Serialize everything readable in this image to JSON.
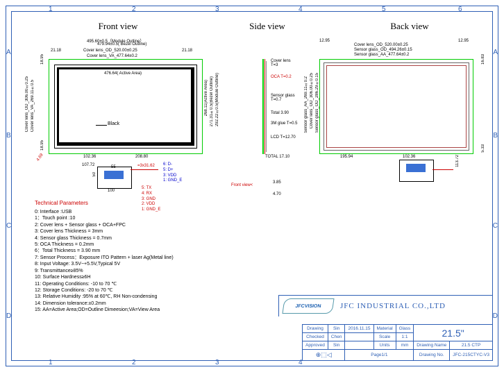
{
  "ruler_cols": [
    "1",
    "2",
    "3",
    "4",
    "5",
    "6"
  ],
  "ruler_rows": [
    "A",
    "B",
    "C",
    "D"
  ],
  "views": {
    "front": "Front view",
    "side": "Side view",
    "back": "Back view"
  },
  "front_dims": {
    "module_outline": "495.60±0.5（Module Outline）",
    "bezel_outline": "479.94±0.5( Bezel Outline)",
    "cover_lens_od": "Cover lens_OD_520.00±0.25",
    "cover_lens_va": "Cover lens_VA_477.64±0.2",
    "left": "21.18",
    "right": "21.18",
    "top_gap_l": "18.95",
    "bot_gap_l": "18.95",
    "active_area": "476.64( Active Area)",
    "vert_od": "Cover lens_OD_306.00±0.25",
    "vert_va": "Cover lens_VA_269.11±0.5",
    "va_268": "268.11(Active Area)",
    "bezel_h": "271.31±0.5(Bezel Outline)",
    "mod_h": "292.22±0.5(Module Outline)",
    "black": "Black",
    "btm_102": "102.36",
    "btm_208": "208.80",
    "btm_107": "107.72",
    "conn_h": "50",
    "conn_w": "100",
    "conn_mid": "55",
    "pitch": "=3x31.62",
    "angle": "4.69"
  },
  "side_dims": {
    "cover_lens": "Cover lens\nT=3",
    "oca": "OCA T=0.2",
    "sensor": "Sensor glass\nT=0.7",
    "total390": "Total 3.90",
    "glue": "3M glue T=0.5",
    "lcd": "LCD T=12.70",
    "total": "TOTAL 17.10",
    "front_arrow": "Front view<",
    "v385": "3.85",
    "v470": "4.70"
  },
  "back_dims": {
    "top_1295": "12.95",
    "cover_od": "Cover lens_OD_520.00±0.25",
    "sensor_od": "Sensor glass_OD_494.26±0.15",
    "sensor_va": "Sensor glass_AA_477.64±0.2",
    "vert_side": "16.83",
    "vert_aa": "Sensor glass_AA_269.11±0.2",
    "vert_od": "Cover lens_OD_306.00±0.25",
    "vert_sod": "Sensor glass_OD_286.29±0.15",
    "vert_533": "5.33",
    "btm_195": "195.94",
    "btm_102": "102.36",
    "btm_113": "113.72"
  },
  "wires_blue": {
    "l6": "6: D-",
    "l5": "5: D+",
    "l3": "3: VDD",
    "l1": "1: GND_E"
  },
  "wires_red": {
    "l5": "5: TX",
    "l4": "4: RX",
    "l3": "3: GND",
    "l2": "2: VDD",
    "l1": "1: GND_E"
  },
  "tech": {
    "title": "Technical Parameters",
    "l0": "0: Interface :USB",
    "l1": "1：Touch point :10",
    "l2": "2: Cover lens + Sensor glass + OCA+FPC",
    "l3": "3: Cover lens Thickness = 3mm",
    "l4": "4: Sensor glass Thickness = 0.7mm",
    "l5": "5: OCA Thickness = 0.2mm",
    "l6": "6：Total Thickness = 3.90 mm",
    "l7": "7: Sensor Process：Exposure ITO Pattern + laser Ag(Metal line)",
    "l8": "8: Input Voltage: 3.5V~+5.5V,Typical 5V",
    "l9": "9: Transmittance≥85%",
    "l10": "10: Surface Hardness≥6H",
    "l11": "11: Operating Conditions: -10 to 70 ℃",
    "l12": "12: Storage Conditions: -20 to 70 ℃",
    "l13": "13: Relative Humidity :95% at 60℃, RH Non-condensing",
    "l14": "14: Dimension tolerance:±0.2mm",
    "l15": "15: AA=Active Area;OD=Outline Dimeesion;VA=View Area"
  },
  "logo": "JFCVISION",
  "company": "JFC INDUSTRIAL CO.,LTD",
  "legend": {
    "drawing": "Drawing",
    "sin": "Sin",
    "date": "2016.11.15",
    "checked": "Checked",
    "chen": "Chen",
    "approved": "Approved",
    "material": "Material",
    "glass": "Glass",
    "scale": "Scale",
    "scale_v": "1:1",
    "units": "Units",
    "units_v": "mm",
    "page": "Page1/1",
    "size": "21.5\"",
    "drawing_name": "Drawing Name",
    "ctp": "21.5 CTP",
    "drawing_no": "Drawing No.",
    "partno": "JFC-215CTYC-V3",
    "proj_sym": "⊕⬚◁"
  }
}
